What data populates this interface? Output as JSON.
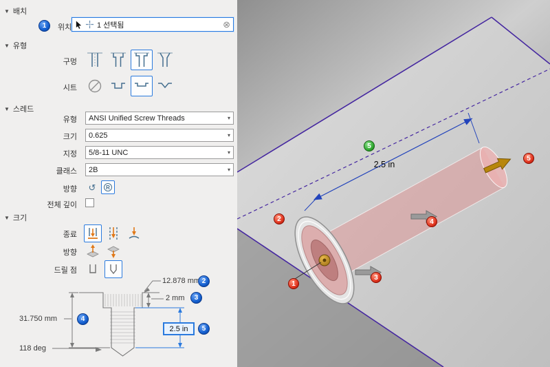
{
  "panel": {
    "placement": {
      "title": "배치",
      "badge": "1",
      "position_label": "위치",
      "position_value": "1 선택됨"
    },
    "type": {
      "title": "유형",
      "hole_label": "구멍",
      "seat_label": "시트"
    },
    "thread": {
      "title": "스레드",
      "type_label": "유형",
      "type_value": "ANSI Unified Screw Threads",
      "size_label": "크기",
      "size_value": "0.625",
      "designation_label": "지정",
      "designation_value": "5/8-11 UNC",
      "class_label": "클래스",
      "class_value": "2B",
      "direction_label": "방향",
      "full_depth_label": "전체 깊이"
    },
    "size": {
      "title": "크기",
      "termination_label": "종료",
      "direction_label": "방향",
      "drill_point_label": "드릴 점",
      "dims": {
        "diameter": "12.878 mm",
        "seat_depth": "2 mm",
        "depth": "31.750 mm",
        "thread_depth": "2.5 in",
        "angle": "118 deg"
      },
      "badges": {
        "diameter": "2",
        "seat_depth": "3",
        "depth": "4",
        "thread_depth": "5"
      }
    }
  },
  "viewport": {
    "dim_label": "2.5 in",
    "green_badge": "5",
    "red_badges": [
      "1",
      "2",
      "3",
      "4",
      "5"
    ]
  },
  "icons": {
    "collapse": "▼",
    "caret": "▾",
    "clear": "⊗",
    "left_hand": "↺",
    "right_hand": "R"
  },
  "colors": {
    "accent_blue": "#2a7ade",
    "edge_purple": "#4527a0",
    "dim_blue": "#2344bb",
    "badge_blue": "#1560d0",
    "badge_red": "#e23822",
    "badge_green": "#35ad35",
    "hole_preview_pink": "#e18c8c",
    "gold": "#b8860b"
  }
}
